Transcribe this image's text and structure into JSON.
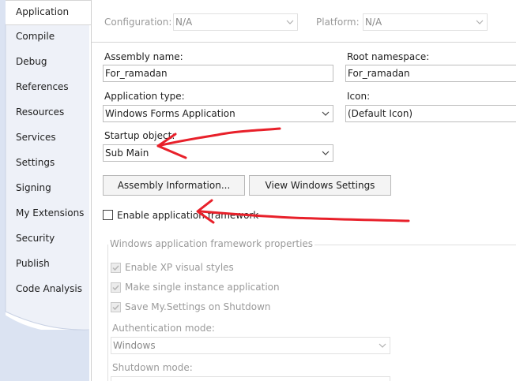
{
  "sidebar": {
    "tabs": [
      {
        "label": "Application",
        "active": true
      },
      {
        "label": "Compile"
      },
      {
        "label": "Debug"
      },
      {
        "label": "References"
      },
      {
        "label": "Resources"
      },
      {
        "label": "Services"
      },
      {
        "label": "Settings"
      },
      {
        "label": "Signing"
      },
      {
        "label": "My Extensions"
      },
      {
        "label": "Security"
      },
      {
        "label": "Publish"
      },
      {
        "label": "Code Analysis"
      }
    ]
  },
  "config": {
    "configuration_label": "Configuration:",
    "configuration_value": "N/A",
    "platform_label": "Platform:",
    "platform_value": "N/A"
  },
  "form": {
    "assembly_name_label": "Assembly name:",
    "assembly_name_value": "For_ramadan",
    "root_namespace_label": "Root namespace:",
    "root_namespace_value": "For_ramadan",
    "application_type_label": "Application type:",
    "application_type_value": "Windows Forms Application",
    "icon_label": "Icon:",
    "icon_value": "(Default Icon)",
    "startup_object_label": "Startup object:",
    "startup_object_value": "Sub Main",
    "assembly_info_button": "Assembly Information...",
    "view_windows_settings_button": "View Windows Settings",
    "enable_framework_label": "Enable application framework",
    "enable_framework_checked": false
  },
  "framework_group": {
    "title": "Windows application framework properties",
    "xp_styles_label": "Enable XP visual styles",
    "single_instance_label": "Make single instance application",
    "save_settings_label": "Save My.Settings on Shutdown",
    "authentication_mode_label": "Authentication mode:",
    "authentication_mode_value": "Windows",
    "shutdown_mode_label": "Shutdown mode:"
  },
  "colors": {
    "sidebar_bg": "#dbe3f2",
    "arrow": "#e8202a"
  }
}
